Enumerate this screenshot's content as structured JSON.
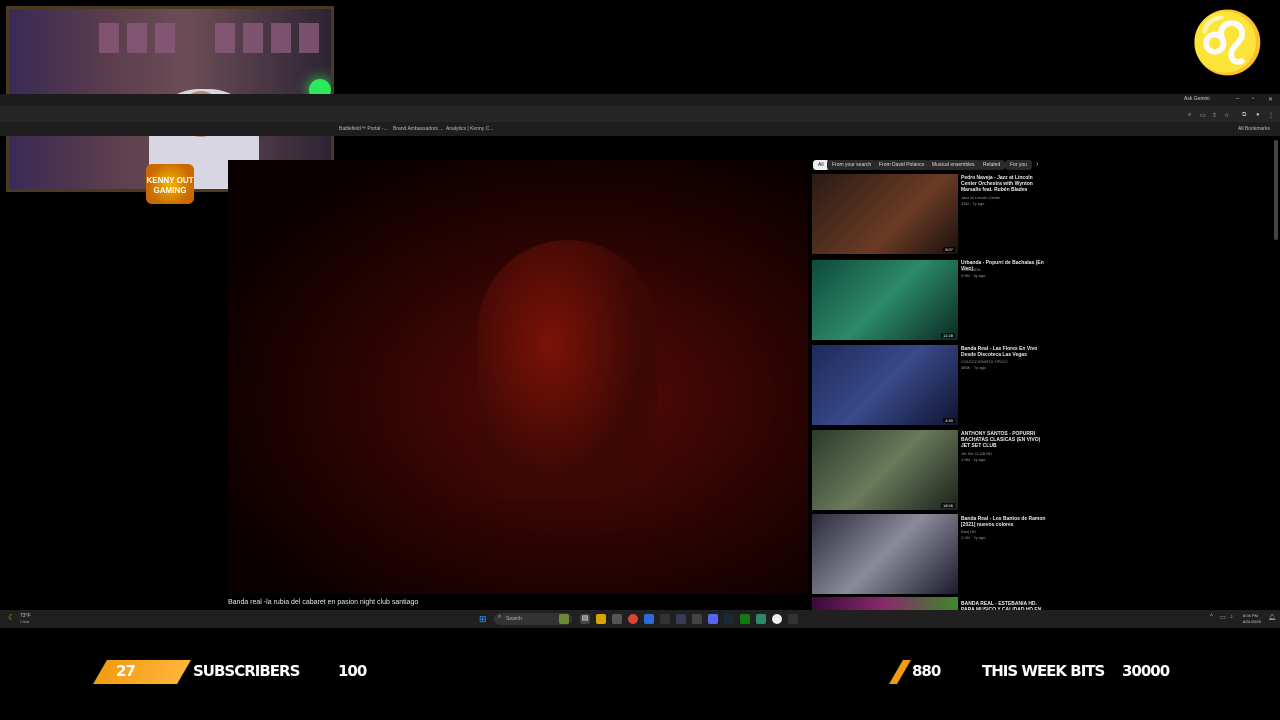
{
  "browser": {
    "ask_gemini": "Ask Gemini",
    "bookmarks": [
      "Battlefield™ Portal -...",
      "Brand Ambassadors ...",
      "Analytics | Kenny C..."
    ],
    "all_bookmarks": "All Bookmarks"
  },
  "video": {
    "title": "Banda real -la rubia del cabaret en pasion night club santiago"
  },
  "chips": [
    "All",
    "From your search",
    "From David Polanco",
    "Musical ensembles",
    "Related",
    "For you"
  ],
  "recommendations": [
    {
      "title": "Pedro Naveja - Jazz at Lincoln Center Orchestra with Wynton Marsalis feat. Rubén Blades",
      "channel": "Jazz at Lincoln Center",
      "meta": "33M · 7y ago",
      "duration": "8:07"
    },
    {
      "title": "Urbanda - Popurrí de Bachatas (En Vivo)",
      "channel": "URBANDA",
      "meta": "9.9M · 4y ago",
      "duration": "12:28"
    },
    {
      "title": "Banda Real - Las Flores En Vivo Desde Discoteca Las Vegas",
      "channel": "COLECCIONISTA TIPICO",
      "meta": "386K · 7y ago",
      "duration": "4:50"
    },
    {
      "title": "ANTHONY SANTOS - POPURRI BACHATAS CLASICAS (EN VIVO) JET SET CLUB",
      "channel": "Jet Set CLUB RD",
      "meta": "1.9M · 1y ago",
      "duration": "18:06"
    },
    {
      "title": "Banda Real - Los Bantos de Ramon [2021] nuevos colores",
      "channel": "Banj HD",
      "meta": "2.0M · 7y ago",
      "duration": ""
    },
    {
      "title": "BANDA REAL - ESTEBANIA HD. PARA MUSICO Y CALIDAD HD EN CANAL",
      "channel": "",
      "meta": "",
      "duration": ""
    }
  ],
  "taskbar": {
    "temp": "73°F",
    "weather": "Clear",
    "search": "Search",
    "time": "8:04 PM",
    "date": "8/31/2025"
  },
  "webcam": {
    "badge": "KENNY OUT GAMING"
  },
  "overlay": {
    "subscribers_count": "27",
    "subscribers_label": "SUBSCRIBERS",
    "subscribers_goal": "100",
    "bits_count": "880",
    "bits_label": "THIS WEEK BITS",
    "bits_goal": "30000"
  },
  "colors": {
    "accent_orange": "#f39c12",
    "background": "#000000"
  }
}
